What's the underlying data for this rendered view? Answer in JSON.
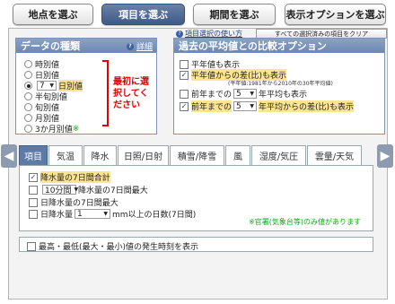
{
  "top_nav": {
    "btn1": "地点を選ぶ",
    "btn2": "項目を選ぶ",
    "btn3": "期間を選ぶ",
    "btn4": "表示オプションを選ぶ"
  },
  "help_link": "項目選択の使い方",
  "clear_button": "すべての選択済みの項目をクリア",
  "data_type": {
    "title": "データの種類",
    "detail_link": "詳細",
    "options": [
      "時別値",
      "日別値",
      "日別値",
      "半旬別値",
      "旬別値",
      "月別値",
      "3か月別値"
    ],
    "day_select_value": "7",
    "star_note": "※",
    "warning": "最初に選択してください"
  },
  "avg_compare": {
    "title": "過去の平均値との比較オプション",
    "item1": "平年値も表示",
    "item2": "平年値からの差(比)も表示",
    "note": "(平年値:1981年から2010年の30年平均値)",
    "item3_prefix": "前年までの",
    "item3_value": "5",
    "item3_suffix": "年平均も表示",
    "item4_prefix": "前年までの",
    "item4_value": "5",
    "item4_suffix": "年平均からの差(比)も表示"
  },
  "tabs": [
    "項目",
    "気温",
    "降水",
    "日照/日射",
    "積雪/降雪",
    "風",
    "湿度/気圧",
    "雲量/天気"
  ],
  "items": {
    "row1": "降水量の7日間合計",
    "row2_select": "10分間",
    "row2_suffix": "降水量の7日間最大",
    "row3": "日降水量の7日間最大",
    "row4_prefix": "日降水量",
    "row4_value": "1",
    "row4_suffix": "mm以上の日数(7日間)",
    "note": "※官署(気象台等)のみ値があります"
  },
  "bottom_option": "最高・最低(最大・最小)値の発生時刻を表示",
  "colors": {
    "accent": "#6c87b1",
    "active_tab": "#5e7aa6",
    "warning": "#e00000",
    "note": "#1aa01a",
    "highlight": "#fbe58f"
  }
}
